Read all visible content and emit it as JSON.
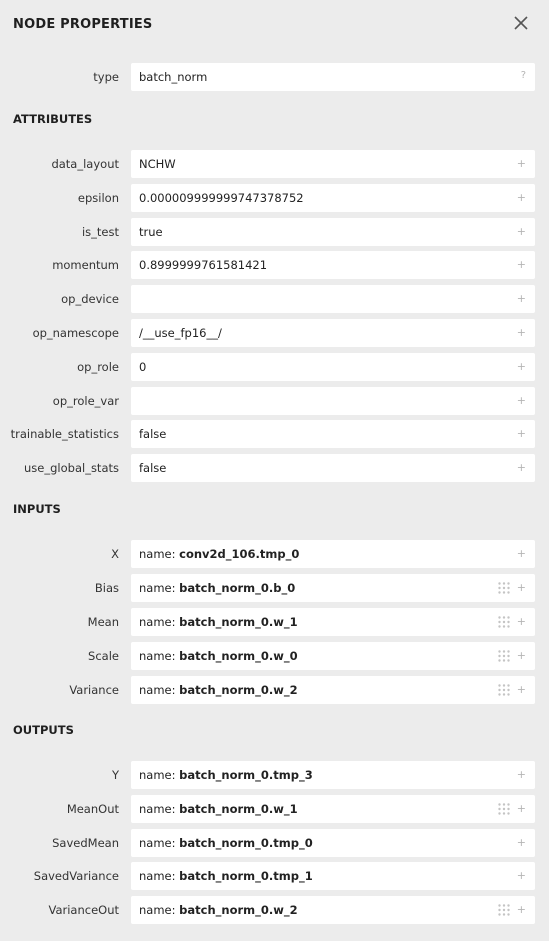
{
  "panel": {
    "title": "NODE PROPERTIES",
    "close_icon": "close-icon"
  },
  "type_row": {
    "label": "type",
    "value": "batch_norm",
    "help": "?"
  },
  "sections": {
    "attributes": "ATTRIBUTES",
    "inputs": "INPUTS",
    "outputs": "OUTPUTS"
  },
  "expand_symbol": "+",
  "name_prefix": "name: ",
  "attributes": [
    {
      "label": "data_layout",
      "value": "NCHW"
    },
    {
      "label": "epsilon",
      "value": "0.000009999999747378752"
    },
    {
      "label": "is_test",
      "value": "true"
    },
    {
      "label": "momentum",
      "value": "0.8999999761581421"
    },
    {
      "label": "op_device",
      "value": ""
    },
    {
      "label": "op_namescope",
      "value": "/__use_fp16__/"
    },
    {
      "label": "op_role",
      "value": "0"
    },
    {
      "label": "op_role_var",
      "value": ""
    },
    {
      "label": "trainable_statistics",
      "value": "false"
    },
    {
      "label": "use_global_stats",
      "value": "false"
    }
  ],
  "inputs": [
    {
      "label": "X",
      "name": "conv2d_106.tmp_0",
      "grip": false
    },
    {
      "label": "Bias",
      "name": "batch_norm_0.b_0",
      "grip": true
    },
    {
      "label": "Mean",
      "name": "batch_norm_0.w_1",
      "grip": true
    },
    {
      "label": "Scale",
      "name": "batch_norm_0.w_0",
      "grip": true
    },
    {
      "label": "Variance",
      "name": "batch_norm_0.w_2",
      "grip": true
    }
  ],
  "outputs": [
    {
      "label": "Y",
      "name": "batch_norm_0.tmp_3",
      "grip": false
    },
    {
      "label": "MeanOut",
      "name": "batch_norm_0.w_1",
      "grip": true
    },
    {
      "label": "SavedMean",
      "name": "batch_norm_0.tmp_0",
      "grip": false
    },
    {
      "label": "SavedVariance",
      "name": "batch_norm_0.tmp_1",
      "grip": false
    },
    {
      "label": "VarianceOut",
      "name": "batch_norm_0.w_2",
      "grip": true
    }
  ]
}
